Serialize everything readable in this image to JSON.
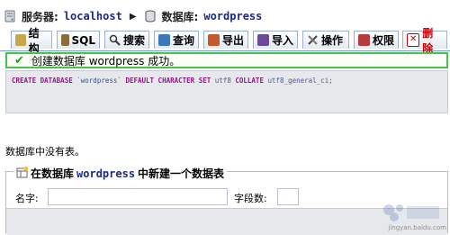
{
  "breadcrumb": {
    "server_label": "服务器:",
    "server_value": "localhost",
    "db_label": "数据库:",
    "db_value": "wordpress"
  },
  "tabs": [
    {
      "label": "结构",
      "icon": "structure-icon"
    },
    {
      "label": "SQL",
      "icon": "sql-icon"
    },
    {
      "label": "搜索",
      "icon": "search-icon"
    },
    {
      "label": "查询",
      "icon": "query-icon"
    },
    {
      "label": "导出",
      "icon": "export-icon"
    },
    {
      "label": "导入",
      "icon": "import-icon"
    },
    {
      "label": "操作",
      "icon": "operations-icon"
    },
    {
      "label": "权限",
      "icon": "privileges-icon"
    },
    {
      "label": "删除",
      "icon": "drop-icon"
    }
  ],
  "message": {
    "text": "创建数据库 wordpress 成功。",
    "color": "#46c34b"
  },
  "sql": {
    "create_database": "CREATE DATABASE",
    "db_name": "`wordpress`",
    "default_charset": "DEFAULT CHARACTER SET",
    "charset": "utf8",
    "collate": "COLLATE",
    "collation": "utf8_general_ci;"
  },
  "no_tables_text": "数据库中没有表。",
  "create_table": {
    "legend_prefix": "在数据库",
    "db_name": "wordpress",
    "legend_suffix": "中新建一个数据表",
    "name_label": "名字:",
    "name_value": "",
    "fields_label": "字段数:",
    "fields_value": ""
  },
  "watermark": {
    "text": "jingyan.baidu.com"
  }
}
